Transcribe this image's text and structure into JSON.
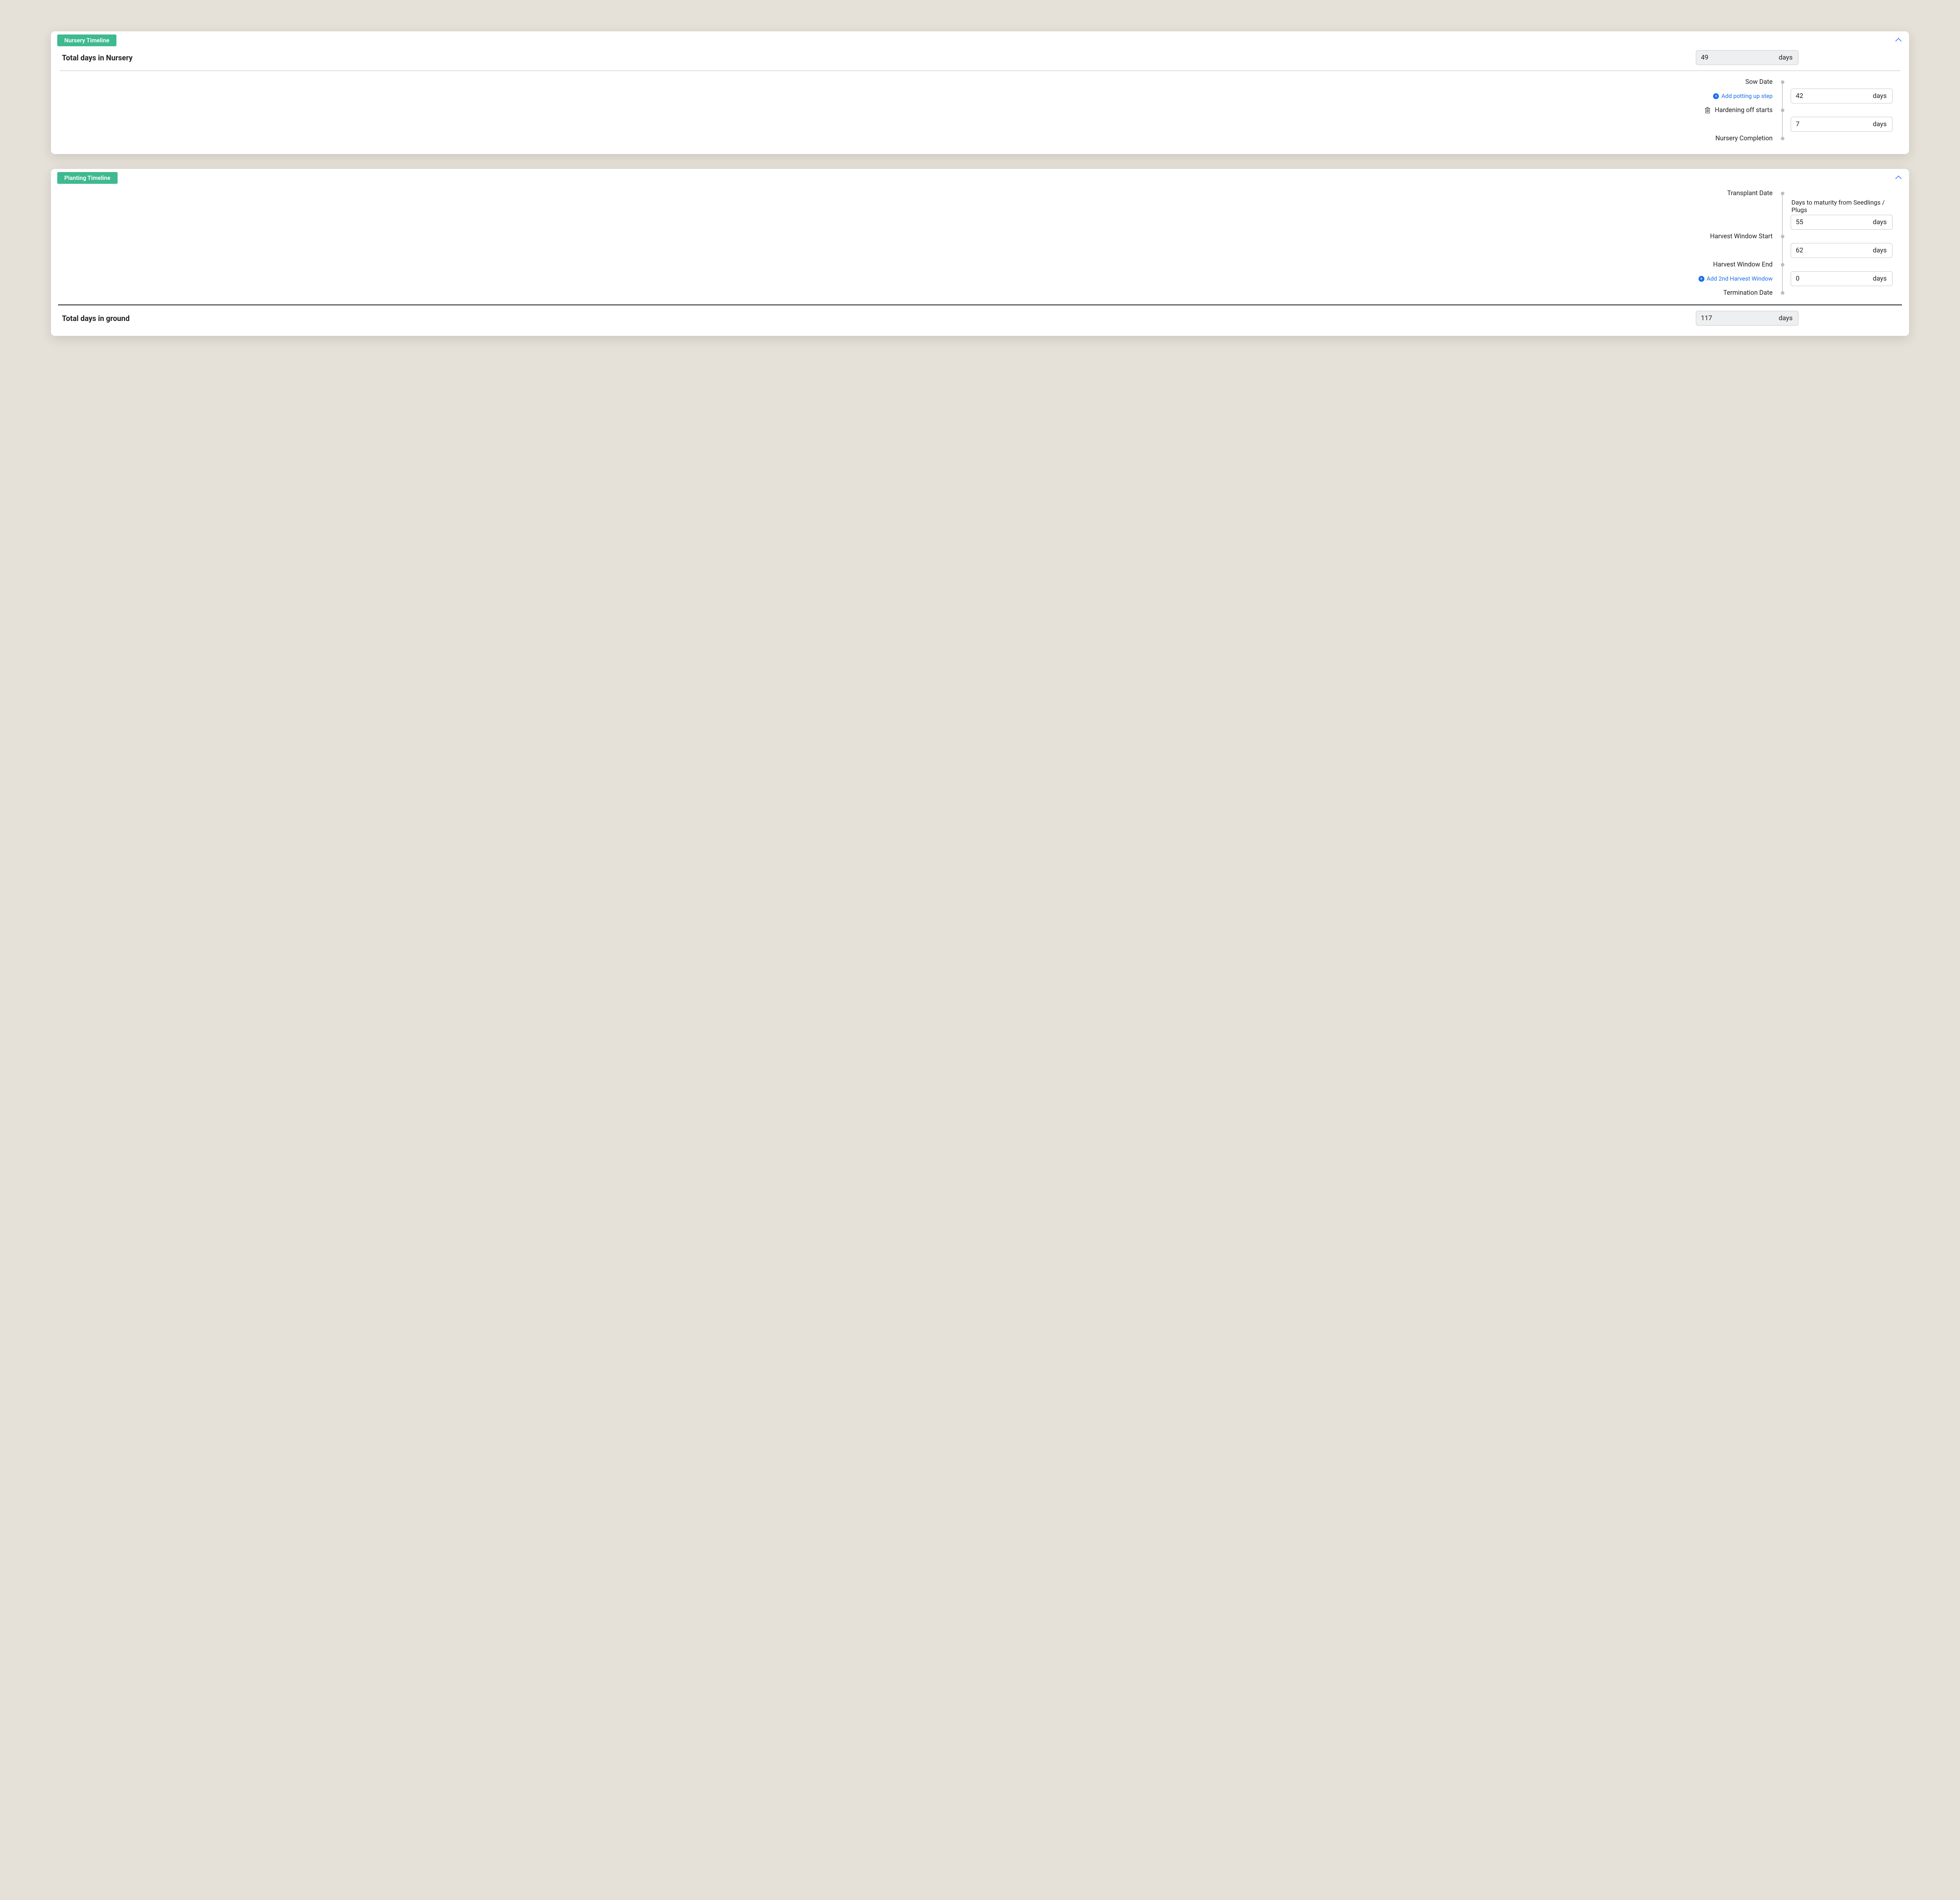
{
  "nursery": {
    "badge": "Nursery Timeline",
    "total_label": "Total days in Nursery",
    "total_value": "49",
    "unit": "days",
    "events": {
      "sow": "Sow Date",
      "add_potting": "Add potting up step",
      "hardening": "Hardening off starts",
      "completion": "Nursery Completion"
    },
    "values": {
      "sow_to_hardening": "42",
      "hardening_to_completion": "7"
    }
  },
  "planting": {
    "badge": "Planting Timeline",
    "events": {
      "transplant": "Transplant Date",
      "maturity_caption": "Days to maturity from Seedlings / Plugs",
      "harvest_start": "Harvest Window Start",
      "harvest_end": "Harvest Window End",
      "add_second_harvest": "Add 2nd Harvest Window",
      "termination": "Termination Date"
    },
    "values": {
      "maturity": "55",
      "harvest_window": "62",
      "end_to_termination": "0"
    },
    "total_label": "Total days in ground",
    "total_value": "117",
    "unit": "days"
  }
}
